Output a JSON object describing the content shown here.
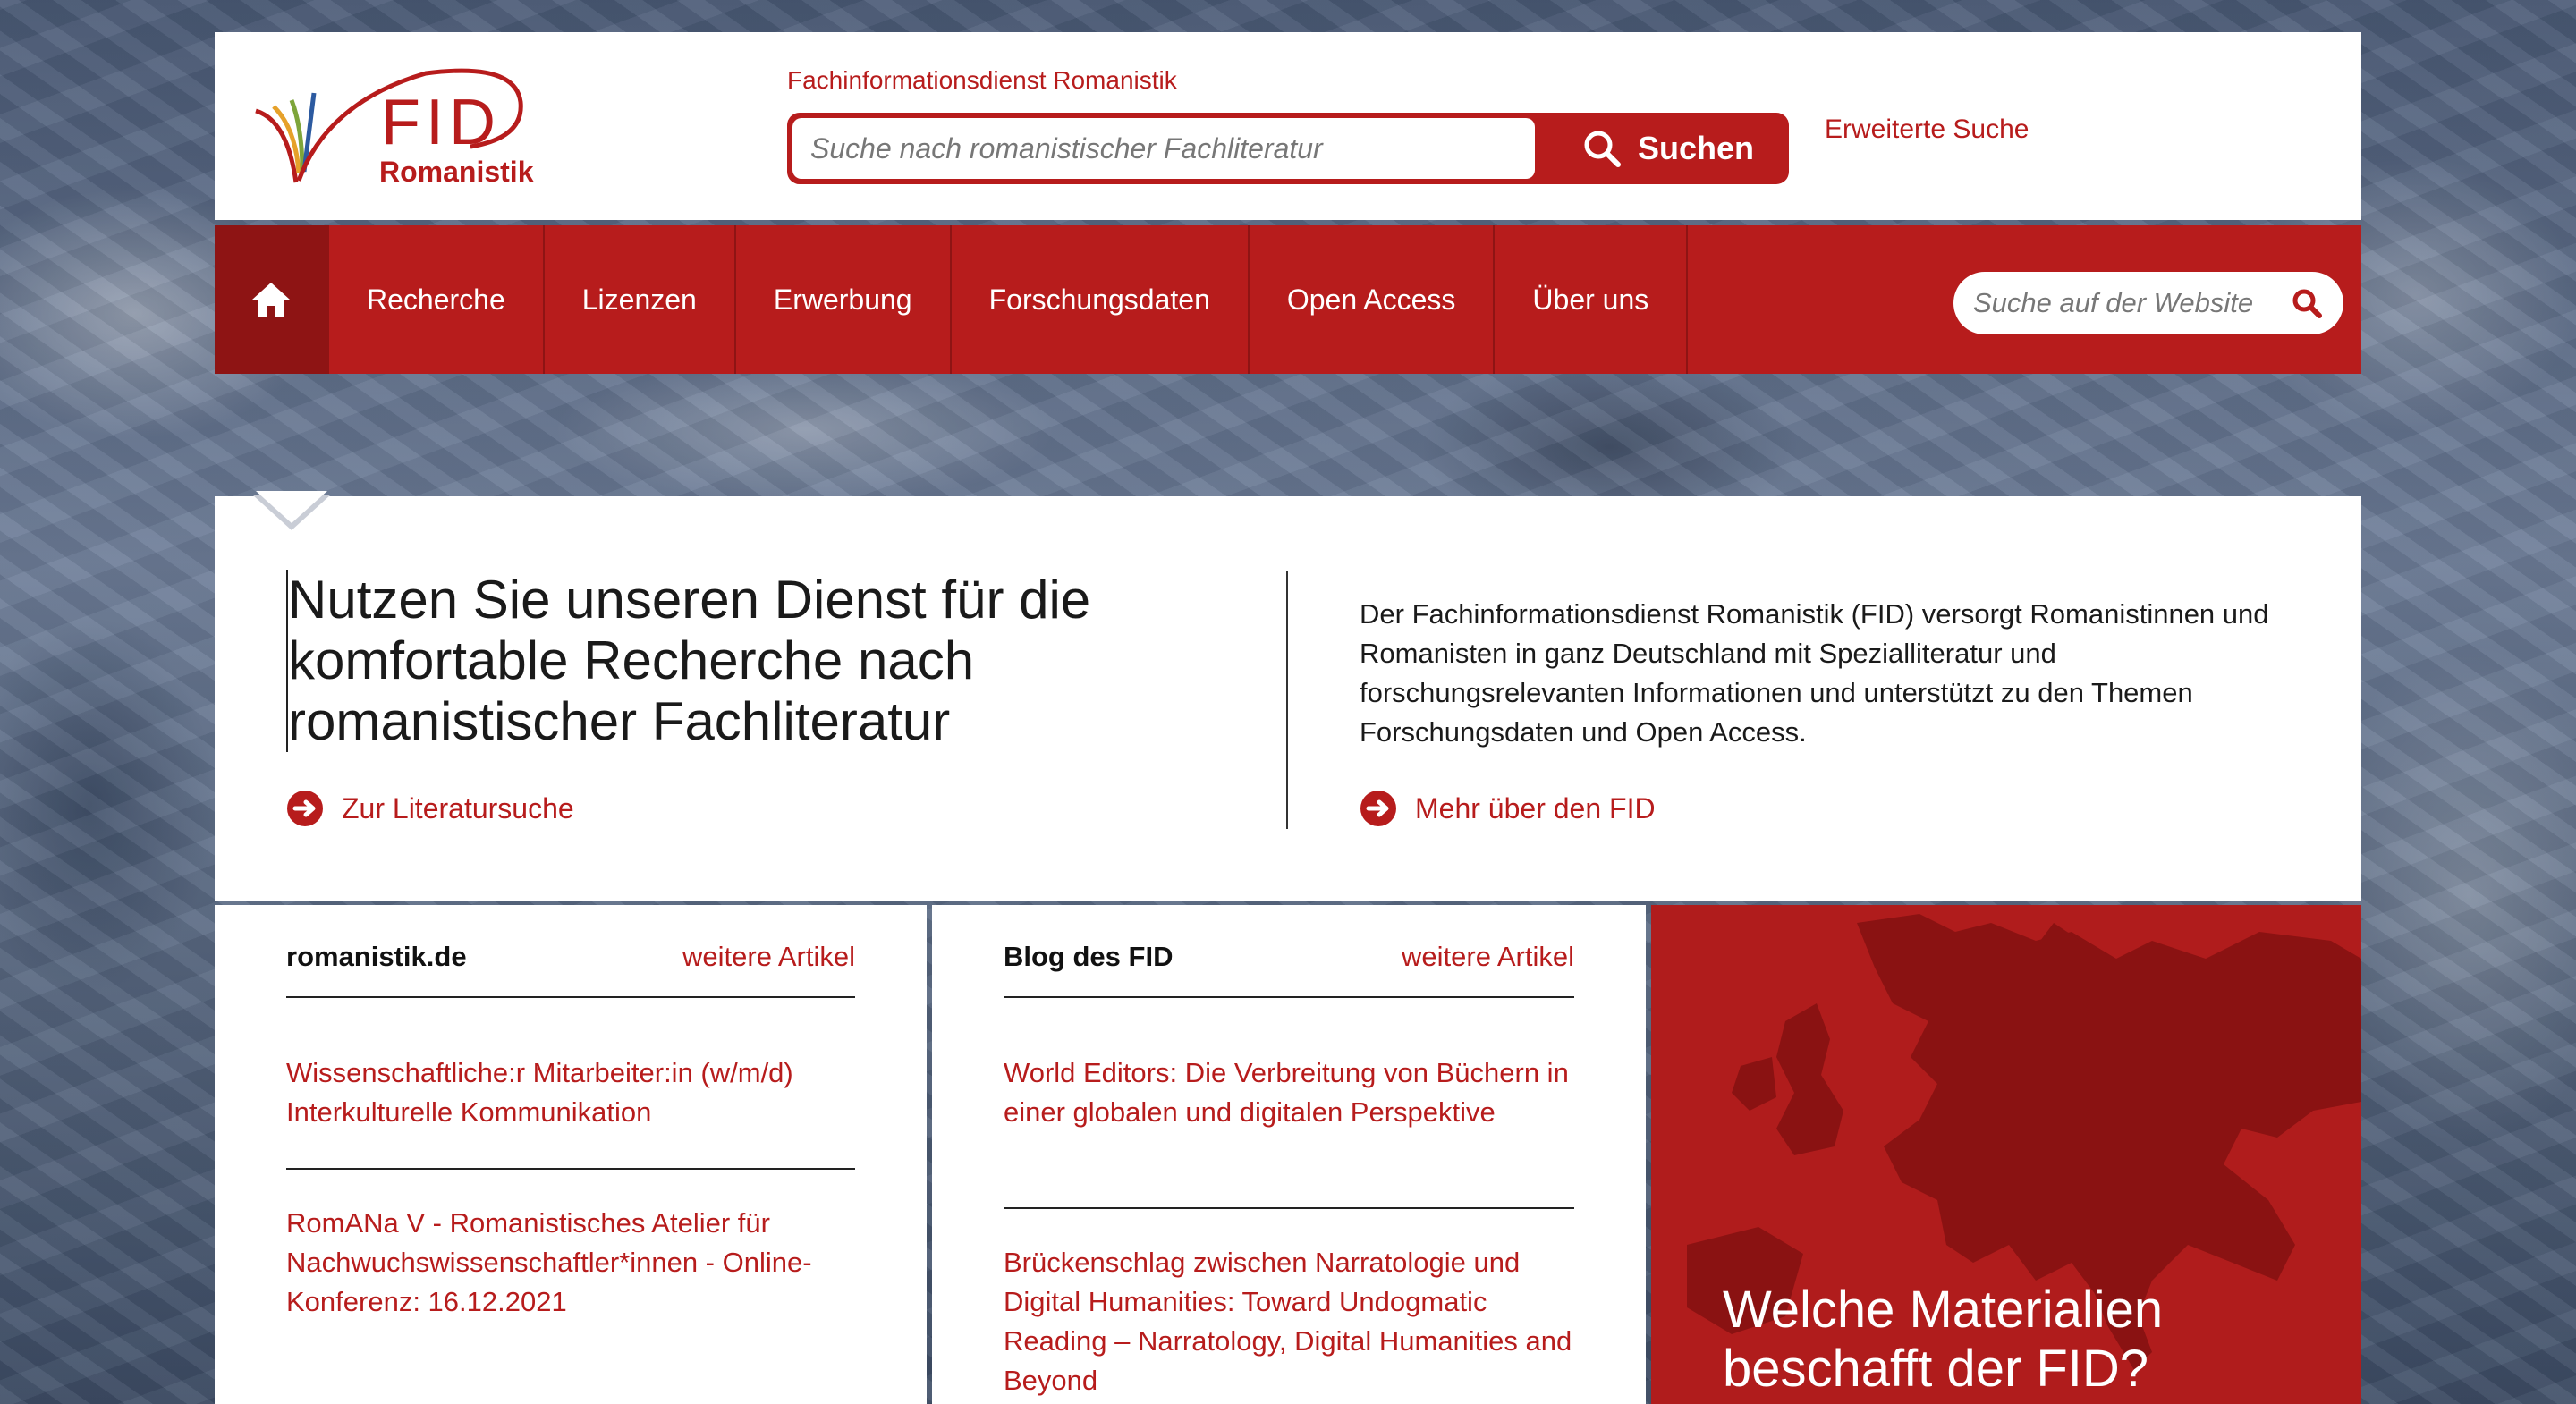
{
  "header": {
    "logo_fid": "FID",
    "logo_romanistik": "Romanistik",
    "service_title": "Fachinformationsdienst Romanistik",
    "search_placeholder": "Suche nach romanistischer Fachliteratur",
    "search_button": "Suchen",
    "advanced_search": "Erweiterte Suche"
  },
  "nav": {
    "home_icon": "home-icon",
    "items": [
      "Recherche",
      "Lizenzen",
      "Erwerbung",
      "Forschungsdaten",
      "Open Access",
      "Über uns"
    ],
    "site_search_placeholder": "Suche auf der Website"
  },
  "intro": {
    "title": "Nutzen Sie unseren Dienst für die komfortable Recherche nach romanistischer Fachliteratur",
    "link_left": "Zur Literatursuche",
    "text": "Der Fachinformationsdienst Romanistik (FID) versorgt Romanistinnen und Romanisten in ganz Deutschland mit Spezialliteratur und forschungsrelevanten Informationen und unterstützt zu den Themen Forschungsdaten und Open Access.",
    "link_right": "Mehr über den FID"
  },
  "columns": [
    {
      "title": "romanistik.de",
      "more": "weitere Artikel",
      "articles": [
        "Wissenschaftliche:r Mitarbeiter:in (w/m/d) Interkulturelle Kommunikation",
        "RomANa V - Romanistisches Atelier für Nachwuchswissenschaftler*innen - Online-Konferenz: 16.12.2021"
      ]
    },
    {
      "title": "Blog des FID",
      "more": "weitere Artikel",
      "articles": [
        "World Editors: Die Verbreitung von Büchern in einer globalen und digitalen Perspektive",
        "Brückenschlag zwischen Narratologie und Digital Humanities: Toward Undogmatic Reading – Narratology, Digital Humanities and Beyond"
      ]
    }
  ],
  "promo": {
    "title": "Welche Materialien beschafft der FID?"
  },
  "colors": {
    "brand_red": "#b71c1c",
    "dark_red": "#8e1414"
  }
}
